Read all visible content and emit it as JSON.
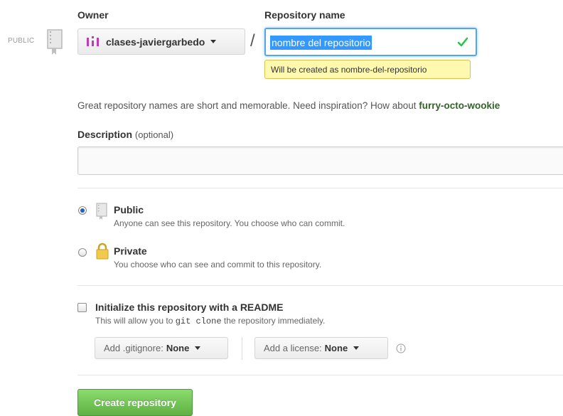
{
  "owner": {
    "label": "Owner",
    "name": "clases-javiergarbedo"
  },
  "separator": "/",
  "repo_name": {
    "label": "Repository name",
    "value": "nombre del repositorio",
    "tooltip": "Will be created as nombre-del-repositorio"
  },
  "visibility_badge": "PUBLIC",
  "inspiration": {
    "text": "Great repository names are short and memorable. Need inspiration? How about",
    "suggestion": "furry-octo-wookie"
  },
  "description": {
    "label": "Description",
    "optional": "(optional)",
    "value": ""
  },
  "visibility": {
    "public": {
      "title": "Public",
      "sub": "Anyone can see this repository. You choose who can commit.",
      "checked": true
    },
    "private": {
      "title": "Private",
      "sub": "You choose who can see and commit to this repository.",
      "checked": false
    }
  },
  "readme": {
    "title": "Initialize this repository with a README",
    "sub_before": "This will allow you to",
    "sub_code": "git clone",
    "sub_after": "the repository immediately.",
    "checked": false
  },
  "gitignore": {
    "prefix": "Add .gitignore:",
    "value": "None"
  },
  "license": {
    "prefix": "Add a license:",
    "value": "None"
  },
  "create_button": "Create repository",
  "colors": {
    "accent_blue": "#51a7e8",
    "create_green": "#60b044",
    "tooltip_yellow": "#fff9b0",
    "suggestion_green": "#34622b"
  }
}
